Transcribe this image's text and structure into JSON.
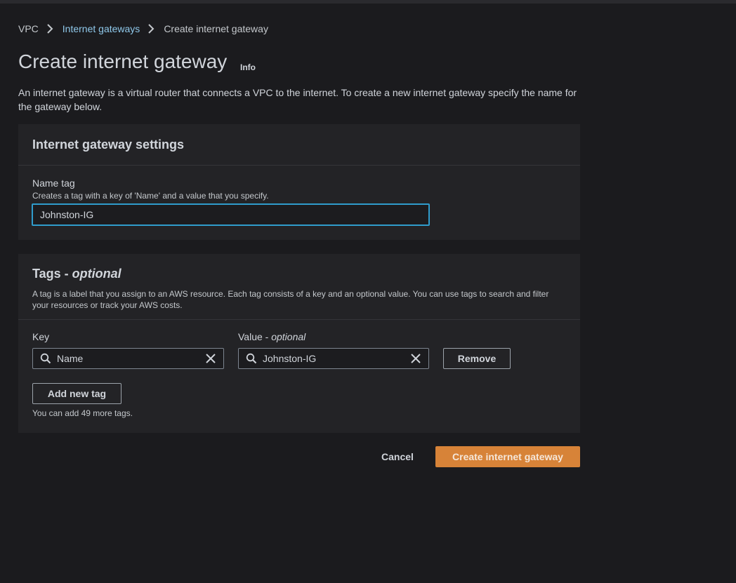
{
  "breadcrumb": {
    "items": [
      "VPC",
      "Internet gateways",
      "Create internet gateway"
    ]
  },
  "header": {
    "title": "Create internet gateway",
    "info_label": "Info",
    "description": "An internet gateway is a virtual router that connects a VPC to the internet. To create a new internet gateway specify the name for the gateway below."
  },
  "settings_panel": {
    "title": "Internet gateway settings",
    "name_tag": {
      "label": "Name tag",
      "hint": "Creates a tag with a key of 'Name' and a value that you specify.",
      "value": "Johnston-IG"
    }
  },
  "tags_panel": {
    "title": "Tags - ",
    "title_optional": "optional",
    "description": "A tag is a label that you assign to an AWS resource. Each tag consists of a key and an optional value. You can use tags to search and filter your resources or track your AWS costs.",
    "key_label": "Key",
    "value_label": "Value - ",
    "value_label_optional": "optional",
    "rows": [
      {
        "key": "Name",
        "value": "Johnston-IG",
        "remove_label": "Remove"
      }
    ],
    "add_tag_label": "Add new tag",
    "remaining_note": "You can add 49 more tags."
  },
  "footer": {
    "cancel_label": "Cancel",
    "submit_label": "Create internet gateway"
  },
  "colors": {
    "background": "#1b1b1e",
    "panel": "#232326",
    "link": "#8fc8ea",
    "focus_border": "#2f9ccc",
    "primary_button": "#d78338"
  },
  "icons": {
    "breadcrumb_separator": "chevron-right-icon",
    "search": "search-icon",
    "clear": "close-icon"
  }
}
